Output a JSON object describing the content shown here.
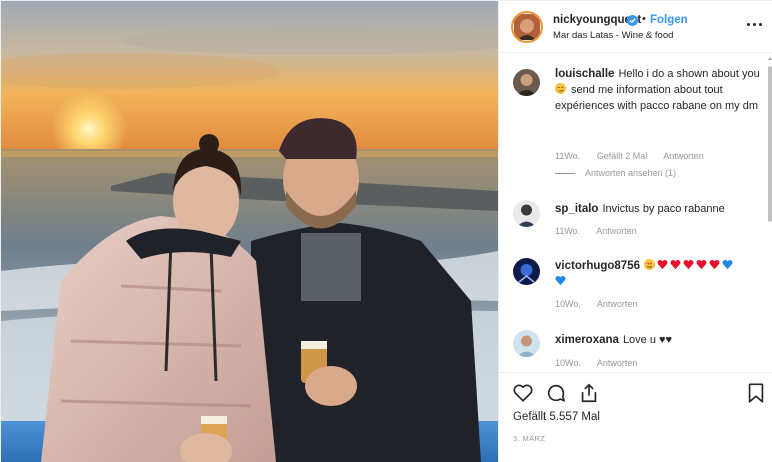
{
  "post": {
    "author": {
      "username": "nickyoungquest",
      "verified": true,
      "follow_label": "Folgen",
      "location": "Mar das Latas - Wine & food"
    },
    "caption_thread": [
      {
        "username": "louischalle",
        "text_before_emoji": "Hello i do a shown about you",
        "emoji": "smirk-emoji",
        "text_after_emoji": " send me information about tout expériences with pacco rabane on my dm",
        "age": "11Wo.",
        "likes": "Gefällt 2 Mal",
        "reply_label": "Antworten",
        "view_replies": "Antworten ansehen (1)"
      },
      {
        "username": "sp_italo",
        "text": "Invictus by paco rabanne",
        "age": "11Wo.",
        "reply_label": "Antworten"
      },
      {
        "username": "victorhugo8756",
        "text": "",
        "emojis": [
          "heart-eyes-emoji",
          "red-heart-emoji",
          "red-heart-emoji",
          "red-heart-emoji",
          "red-heart-emoji",
          "red-heart-emoji",
          "blue-heart-emoji",
          "blue-heart-emoji"
        ],
        "age": "10Wo.",
        "reply_label": "Antworten"
      },
      {
        "username": "ximeroxana",
        "text": "Love u ♥♥",
        "age": "10Wo.",
        "reply_label": "Antworten"
      }
    ],
    "likes_text": "Gefällt 5.557 Mal",
    "date": "3. MÄRZ",
    "icons": [
      "heart-icon",
      "comment-icon",
      "share-icon",
      "bookmark-icon",
      "more-options-icon",
      "verified-badge-icon"
    ],
    "colors": {
      "link_blue": "#3897f0",
      "secondary_text": "#999999",
      "primary_text": "#262626",
      "emoji_red": "#e8112d",
      "emoji_blue": "#1e88e5"
    }
  }
}
